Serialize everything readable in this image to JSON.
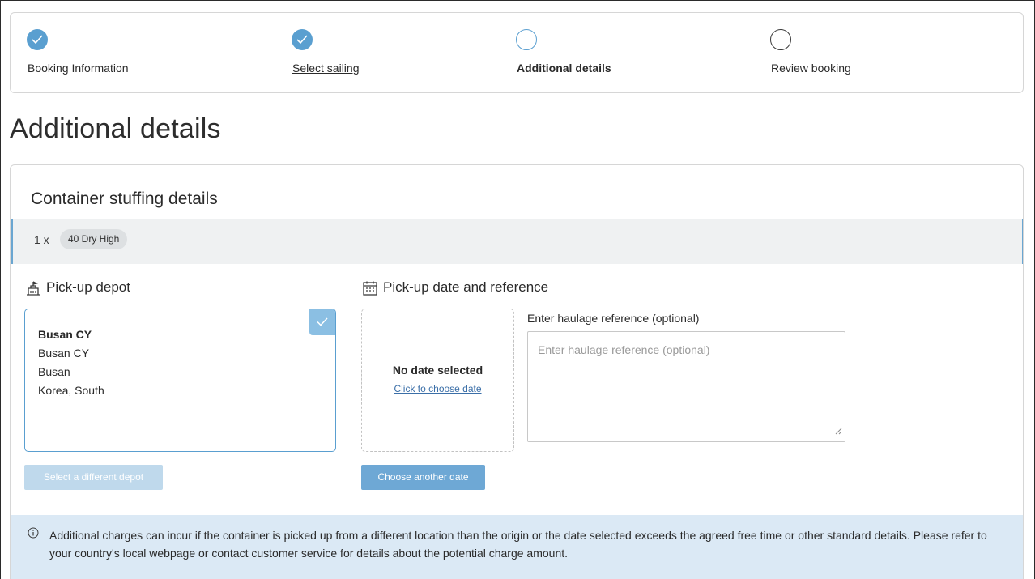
{
  "stepper": {
    "steps": [
      {
        "label": "Booking Information",
        "state": "done"
      },
      {
        "label": "Select sailing",
        "state": "done"
      },
      {
        "label": "Additional details",
        "state": "current"
      },
      {
        "label": "Review booking",
        "state": "todo"
      }
    ]
  },
  "page": {
    "title": "Additional details"
  },
  "stuffing": {
    "title": "Container stuffing details",
    "quantity": "1 x",
    "container_type": "40 Dry High"
  },
  "depot": {
    "heading": "Pick-up depot",
    "name": "Busan CY",
    "line2": "Busan CY",
    "city": "Busan",
    "country": "Korea, South",
    "change_button": "Select a different depot"
  },
  "pickup": {
    "heading": "Pick-up date and reference",
    "no_date": "No date selected",
    "choose_link": "Click to choose date",
    "choose_button": "Choose another date",
    "ref_label": "Enter haulage reference (optional)",
    "ref_placeholder": "Enter haulage reference (optional)"
  },
  "info": {
    "text": "Additional charges can incur if the container is picked up from a different location than the origin or the date selected exceeds the agreed free time or other standard details. Please refer to your country's local webpage or contact customer service for details about the potential charge amount."
  },
  "colors": {
    "accent": "#5a9fd0",
    "info_bg": "#dbe9f5"
  }
}
